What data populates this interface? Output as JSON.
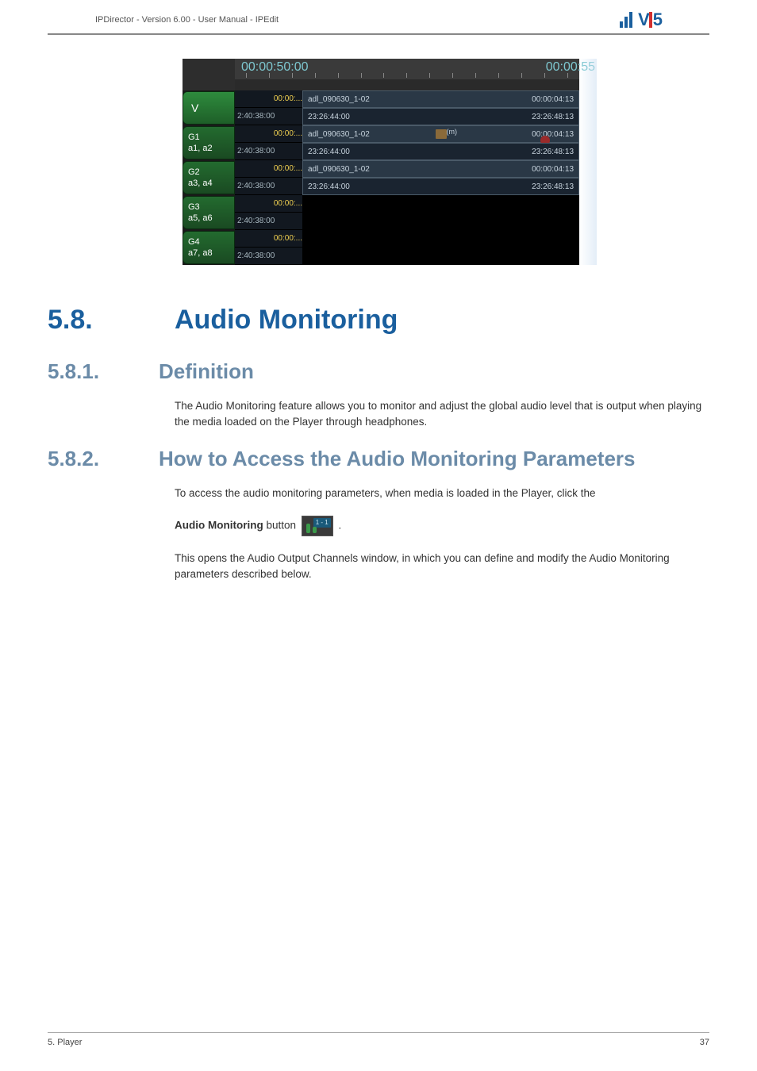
{
  "header": {
    "breadcrumb": "IPDirector - Version 6.00 - User Manual - IPEdit",
    "logo_text": "VS"
  },
  "timeline": {
    "ruler_left_time": "00:00:50:00",
    "ruler_right_time": "00:00:55",
    "tracks": [
      {
        "label_main": "V",
        "label_sub": "",
        "cell_top": "00:00:...",
        "cell_bottom": "2:40:38:00",
        "clip_name": "adl_090630_1-02",
        "clip_tc_top": "00:00:04:13",
        "clip_name_b": "23:26:44:00",
        "clip_tc_bottom": "23:26:48:13",
        "has_clip": true,
        "has_icons": false
      },
      {
        "label_main": "G1",
        "label_sub": "a1, a2",
        "cell_top": "00:00:...",
        "cell_bottom": "2:40:38:00",
        "clip_name": "adl_090630_1-02",
        "clip_tc_top": "00:00:04:13",
        "clip_name_b": "23:26:44:00",
        "clip_tc_bottom": "23:26:48:13",
        "has_clip": true,
        "has_icons": true
      },
      {
        "label_main": "G2",
        "label_sub": "a3, a4",
        "cell_top": "00:00:...",
        "cell_bottom": "2:40:38:00",
        "clip_name": "adl_090630_1-02",
        "clip_tc_top": "00:00:04:13",
        "clip_name_b": "23:26:44:00",
        "clip_tc_bottom": "23:26:48:13",
        "has_clip": true,
        "has_icons": false
      },
      {
        "label_main": "G3",
        "label_sub": "a5, a6",
        "cell_top": "00:00:...",
        "cell_bottom": "2:40:38:00",
        "has_clip": false
      },
      {
        "label_main": "G4",
        "label_sub": "a7, a8",
        "cell_top": "00:00:...",
        "cell_bottom": "2:40:38:00",
        "has_clip": false
      }
    ]
  },
  "section": {
    "num": "5.8.",
    "title": "Audio Monitoring"
  },
  "sub1": {
    "num": "5.8.1.",
    "title": "Definition",
    "body": "The Audio Monitoring feature allows you to monitor and adjust the global audio level that is output when playing the media loaded on the Player through headphones."
  },
  "sub2": {
    "num": "5.8.2.",
    "title": "How to Access the Audio Monitoring Parameters",
    "body1": "To access the audio monitoring parameters, when media is loaded in the Player, click the",
    "body2a": "Audio Monitoring",
    "body2b": " button ",
    "body2c": " .",
    "body3": "This opens the Audio Output Channels window, in which you can define and modify the Audio Monitoring parameters described below.",
    "button_badge": "1 - 1"
  },
  "footer": {
    "left": "5. Player",
    "right": "37"
  }
}
